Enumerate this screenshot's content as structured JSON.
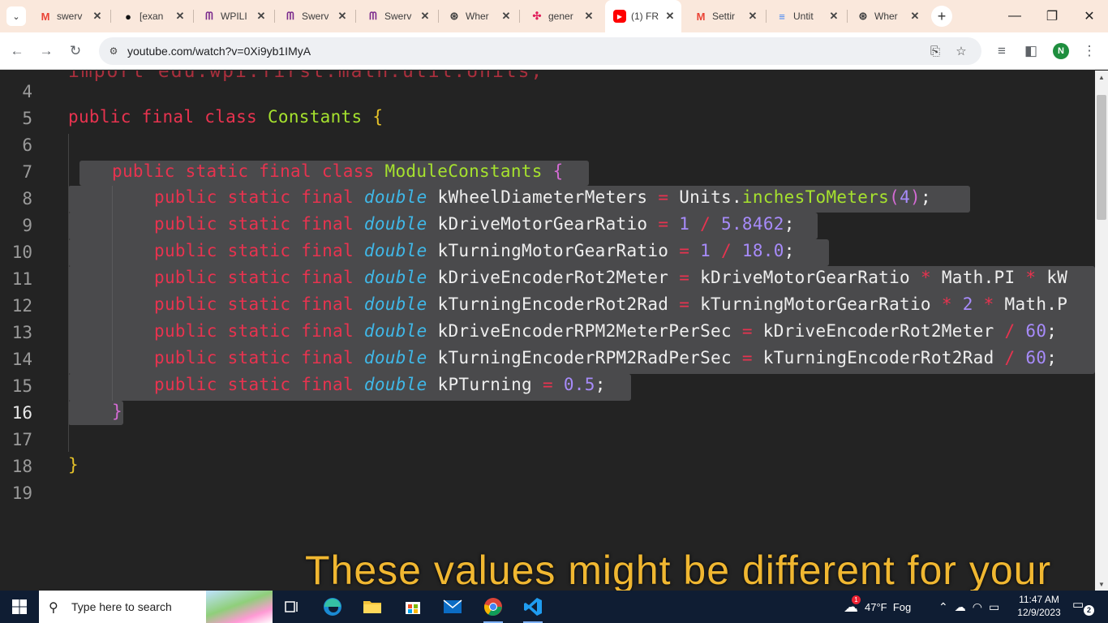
{
  "browser": {
    "tabs": [
      {
        "title": "swerv",
        "favicon": "gmail-icon"
      },
      {
        "title": "[exan",
        "favicon": "github-icon"
      },
      {
        "title": "WPILI",
        "favicon": "wpilib-icon"
      },
      {
        "title": "Swerv",
        "favicon": "wpilib-icon"
      },
      {
        "title": "Swerv",
        "favicon": "wpilib-icon"
      },
      {
        "title": "Wher",
        "favicon": "chatgpt-icon"
      },
      {
        "title": "gener",
        "favicon": "slack-icon"
      },
      {
        "title": "(1) FR",
        "favicon": "youtube-icon",
        "active": true
      },
      {
        "title": "Settir",
        "favicon": "gmail-icon"
      },
      {
        "title": "Untit",
        "favicon": "docs-icon"
      },
      {
        "title": "Wher",
        "favicon": "chatgpt-icon"
      }
    ],
    "close_glyph": "✕",
    "new_tab_glyph": "+",
    "url": "youtube.com/watch?v=0Xi9yb1IMyA",
    "profile_initial": "N"
  },
  "video": {
    "line_numbers": [
      "4",
      "5",
      "6",
      "7",
      "8",
      "9",
      "10",
      "11",
      "12",
      "13",
      "14",
      "15",
      "16",
      "17",
      "18",
      "19"
    ],
    "current_line": "16",
    "code": {
      "top_partial": "import edu.wpi.first.math.util.Units;",
      "l5": {
        "kw": "public final class",
        "name": "Constants",
        "brace": "{"
      },
      "l7": {
        "kw": "public static final class",
        "name": "ModuleConstants",
        "brace": "{"
      },
      "kw_field": "public static final",
      "type": "double",
      "l8": {
        "name": "kWheelDiameterMeters",
        "eq": "=",
        "obj": "Units.",
        "fn": "inchesToMeters",
        "open": "(",
        "arg": "4",
        "close": ")",
        "semi": ";"
      },
      "l9": {
        "name": "kDriveMotorGearRatio",
        "eq": "=",
        "a": "1",
        "op": "/",
        "b": "5.8462",
        "semi": ";"
      },
      "l10": {
        "name": "kTurningMotorGearRatio",
        "eq": "=",
        "a": "1",
        "op": "/",
        "b": "18.0",
        "semi": ";"
      },
      "l11": {
        "name": "kDriveEncoderRot2Meter",
        "eq": "=",
        "a": "kDriveMotorGearRatio",
        "op1": "*",
        "b": "Math.PI",
        "op2": "*",
        "c": "kW"
      },
      "l12": {
        "name": "kTurningEncoderRot2Rad",
        "eq": "=",
        "a": "kTurningMotorGearRatio",
        "op1": "*",
        "b": "2",
        "op2": "*",
        "c": "Math.P"
      },
      "l13": {
        "name": "kDriveEncoderRPM2MeterPerSec",
        "eq": "=",
        "a": "kDriveEncoderRot2Meter",
        "op": "/",
        "b": "60",
        "semi": ";"
      },
      "l14": {
        "name": "kTurningEncoderRPM2RadPerSec",
        "eq": "=",
        "a": "kTurningEncoderRot2Rad",
        "op": "/",
        "b": "60",
        "semi": ";"
      },
      "l15": {
        "name": "kPTurning",
        "eq": "=",
        "val": "0.5",
        "semi": ";"
      },
      "l16_brace": "}",
      "l18_brace": "}"
    },
    "caption": "These values might be different for your"
  },
  "taskbar": {
    "search_placeholder": "Type here to search",
    "weather": "47°F  Fog",
    "weather_alert": "1",
    "time": "11:47 AM",
    "date": "12/9/2023",
    "notification_count": "2"
  },
  "colors": {
    "tabstrip_bg": "#fae8dc",
    "keyword": "#e8334f",
    "class_name": "#a6e22e",
    "type": "#3fb8e8",
    "number": "#a78bfa",
    "caption": "#f0b731",
    "taskbar_bg": "#0f1d33"
  }
}
